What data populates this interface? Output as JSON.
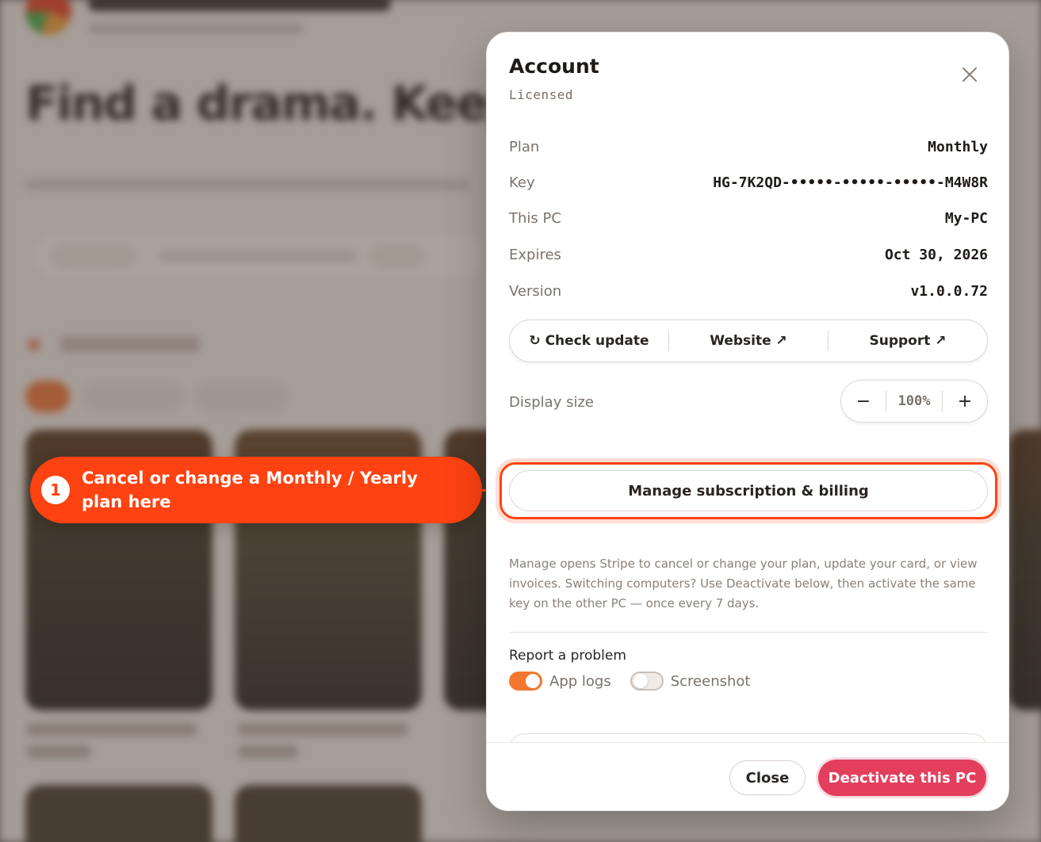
{
  "background": {
    "hero_text": "Find a drama. Keep t"
  },
  "callout": {
    "number": "1",
    "text": "Cancel or change a Monthly / Yearly plan here"
  },
  "modal": {
    "title": "Account",
    "status": "Licensed",
    "rows": [
      {
        "label": "Plan",
        "value": "Monthly"
      },
      {
        "label": "Key",
        "value": "HG-7K2QD-•••••-•••••-•••••-M4W8R"
      },
      {
        "label": "This PC",
        "value": "My-PC"
      },
      {
        "label": "Expires",
        "value": "Oct 30, 2026"
      },
      {
        "label": "Version",
        "value": "v1.0.0.72"
      }
    ],
    "actions": {
      "check_update": "↻ Check update",
      "website": "Website ↗",
      "support": "Support ↗"
    },
    "display_size": {
      "label": "Display size",
      "minus": "−",
      "value": "100%",
      "plus": "+"
    },
    "manage_label": "Manage subscription & billing",
    "help_text": "Manage opens Stripe to cancel or change your plan, update your card, or view invoices. Switching computers? Use Deactivate below, then activate the same key on the other PC — once every 7 days.",
    "report": {
      "title": "Report a problem",
      "app_logs": {
        "label": "App logs",
        "on": true
      },
      "screenshot": {
        "label": "Screenshot",
        "on": false
      }
    },
    "footer": {
      "close_label": "Close",
      "deactivate_label": "Deactivate this PC"
    }
  },
  "colors": {
    "accent": "#fe4211",
    "toggle_on": "#f3782d",
    "danger": "#e33f5d"
  }
}
